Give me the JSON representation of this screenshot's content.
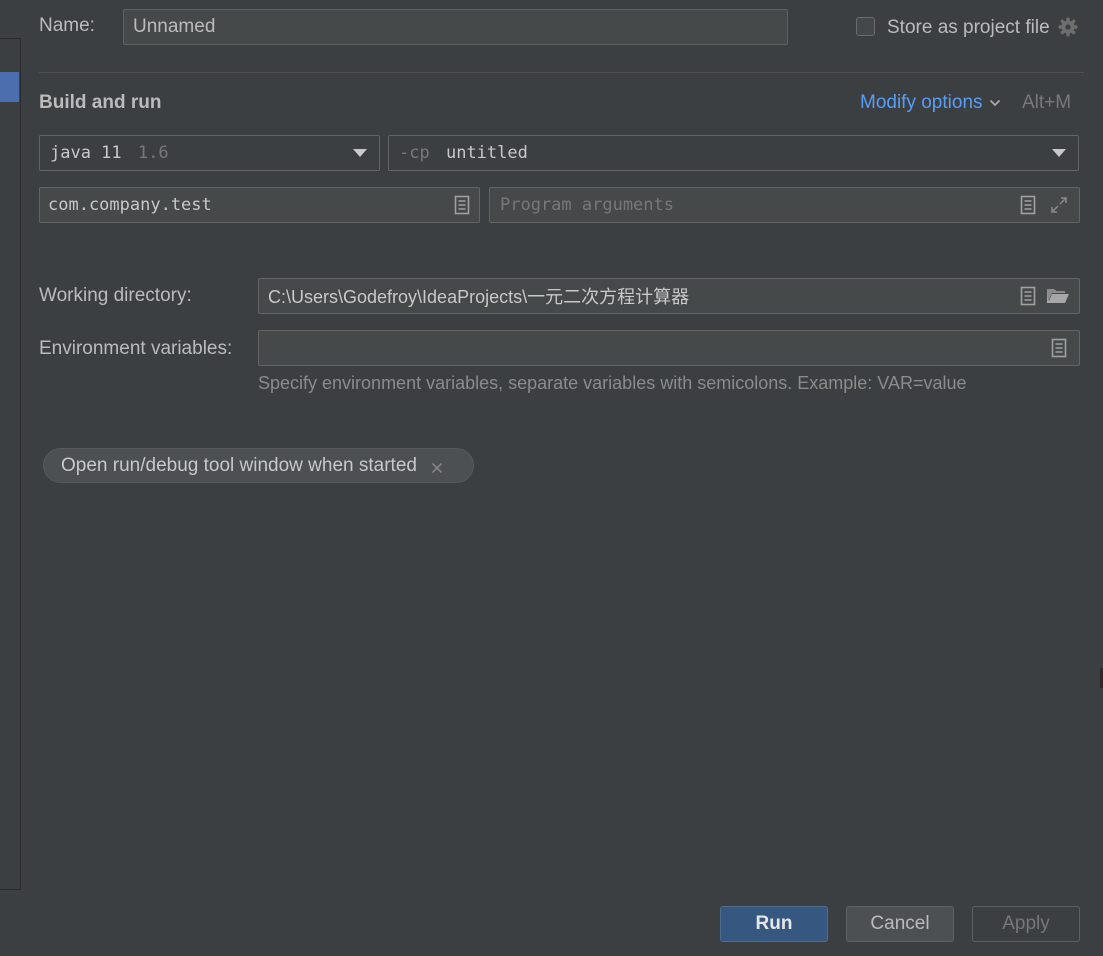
{
  "name": {
    "label": "Name:",
    "value": "Unnamed"
  },
  "store_project": {
    "label": "Store as project file",
    "checked": false
  },
  "section": {
    "title": "Build and run"
  },
  "modify_options": {
    "label": "Modify options",
    "shortcut": "Alt+M"
  },
  "jre": {
    "value": "java 11",
    "version": "1.6"
  },
  "classpath": {
    "prefix": "-cp",
    "value": "untitled"
  },
  "main_class": {
    "value": "com.company.test"
  },
  "program_args": {
    "placeholder": "Program arguments"
  },
  "working_dir": {
    "label": "Working directory:",
    "value": "C:\\Users\\Godefroy\\IdeaProjects\\一元二次方程计算器"
  },
  "env_vars": {
    "label": "Environment variables:",
    "value": "",
    "hint": "Specify environment variables, separate variables with semicolons. Example: VAR=value"
  },
  "chip": {
    "label": "Open run/debug tool window when started"
  },
  "buttons": {
    "run": "Run",
    "cancel": "Cancel",
    "apply": "Apply"
  },
  "colors": {
    "background": "#3c3f41",
    "field": "#45494a",
    "accent": "#589df6",
    "run_button": "#365880",
    "selection": "#4b6eaf"
  }
}
